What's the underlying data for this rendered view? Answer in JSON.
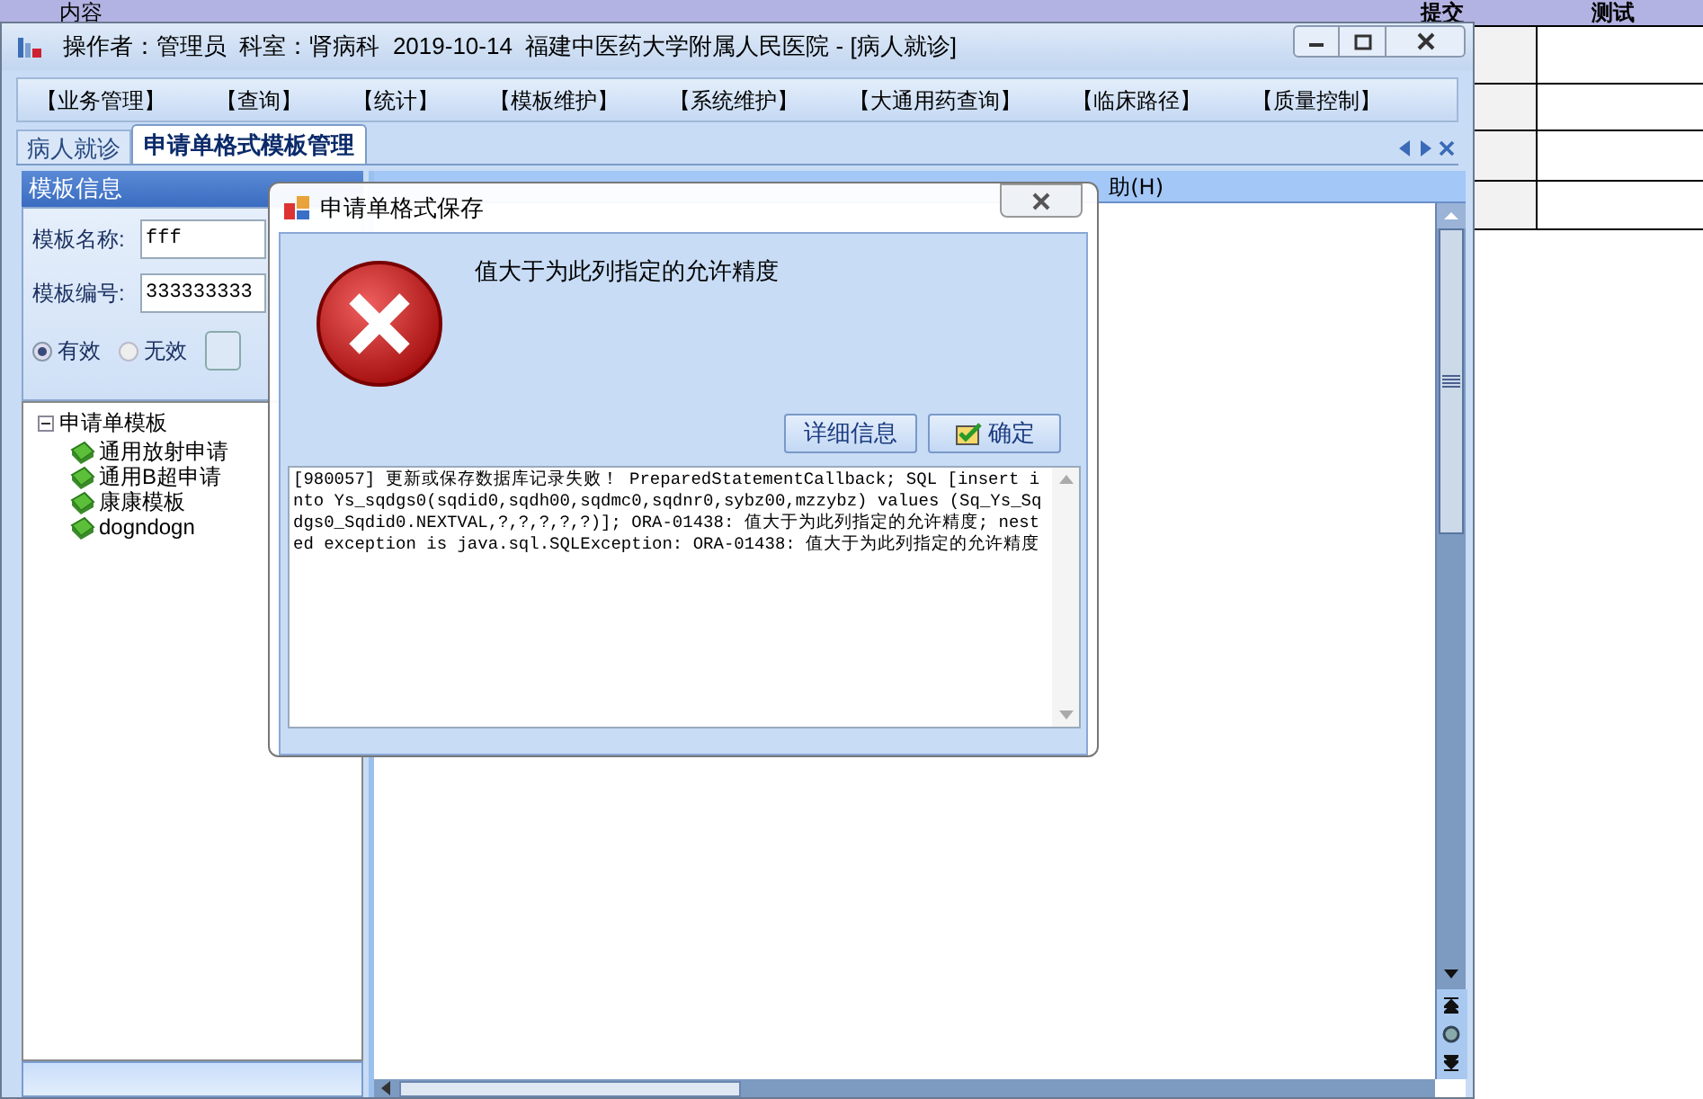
{
  "background_table": {
    "columns": [
      "内容",
      "提交",
      "测试"
    ]
  },
  "window": {
    "title": "操作者：管理员  科室：肾病科  2019-10-14  福建中医药大学附属人民医院 - [病人就诊]"
  },
  "menu": [
    "【业务管理】",
    "【查询】",
    "【统计】",
    "【模板维护】",
    "【系统维护】",
    "【大通用药查询】",
    "【临床路径】",
    "【质量控制】"
  ],
  "tabs": [
    {
      "label": "病人就诊",
      "selected": false
    },
    {
      "label": "申请单格式模板管理",
      "selected": true
    }
  ],
  "template_panel": {
    "title": "模板信息",
    "fields": [
      {
        "label": "模板名称:",
        "value": "fff"
      },
      {
        "label": "模板编号:",
        "value": "333333333"
      }
    ],
    "status_options": [
      {
        "label": "有效",
        "selected": true
      },
      {
        "label": "无效",
        "selected": false
      }
    ]
  },
  "tree": {
    "label": "申请单模板",
    "expanded": true,
    "children": [
      {
        "label": "通用放射申请"
      },
      {
        "label": "通用B超申请"
      },
      {
        "label": "康康模板"
      },
      {
        "label": "dogndogn"
      }
    ]
  },
  "toolbar_fragment": "助(H)",
  "dialog": {
    "title": "申请单格式保存",
    "message": "值大于为此列指定的允许精度",
    "buttons": [
      {
        "label": "详细信息",
        "kind": "details"
      },
      {
        "label": "确定",
        "kind": "ok"
      }
    ],
    "details": " [980057] 更新或保存数据库记录失败！ PreparedStatementCallback; SQL [insert into Ys_sqdgs0(sqdid0,sqdh00,sqdmc0,sqdnr0,sybz00,mzzybz) values (Sq_Ys_Sqdgs0_Sqdid0.NEXTVAL,?,?,?,?,?)]; ORA-01438: 值大于为此列指定的允许精度; nested exception is java.sql.SQLException: ORA-01438: 值大于为此列指定的允许精度"
  }
}
